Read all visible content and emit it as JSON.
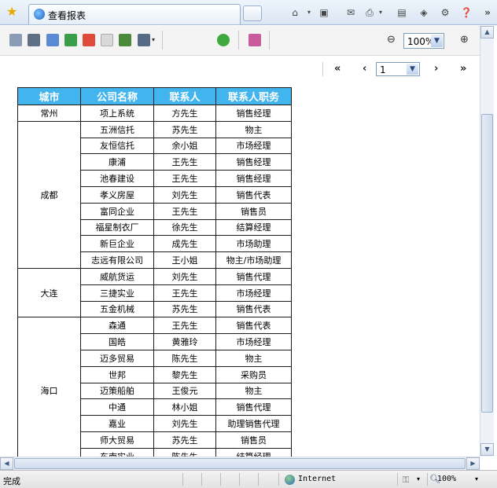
{
  "browser": {
    "tab_title": "查看报表",
    "status_text": "完成",
    "zone": "Internet",
    "zoom_status": "100%"
  },
  "toolbar": {
    "zoom_value": "100%",
    "buttons": [
      "preview-icon",
      "print-icon",
      "export-icon",
      "excel-icon",
      "pdf-icon",
      "text-icon",
      "save-icon",
      "view-menu-icon",
      "refresh-icon",
      "rss-icon"
    ]
  },
  "pager": {
    "first": "«",
    "prev": "‹",
    "page": "1",
    "next": "›",
    "last": "»"
  },
  "report": {
    "columns": [
      "城市",
      "公司名称",
      "联系人",
      "联系人职务"
    ],
    "groups": [
      {
        "city": "常州",
        "rows": [
          [
            "项上系统",
            "方先生",
            "销售经理"
          ]
        ]
      },
      {
        "city": "成都",
        "rows": [
          [
            "五洲信托",
            "苏先生",
            "物主"
          ],
          [
            "友恒信托",
            "余小姐",
            "市场经理"
          ],
          [
            "康浦",
            "王先生",
            "销售经理"
          ],
          [
            "池春建设",
            "王先生",
            "销售经理"
          ],
          [
            "孝义房屋",
            "刘先生",
            "销售代表"
          ],
          [
            "富同企业",
            "王先生",
            "销售员"
          ],
          [
            "福星制衣厂",
            "徐先生",
            "结算经理"
          ],
          [
            "新巨企业",
            "成先生",
            "市场助理"
          ],
          [
            "志远有限公司",
            "王小姐",
            "物主/市场助理"
          ]
        ]
      },
      {
        "city": "大连",
        "rows": [
          [
            "威航货运",
            "刘先生",
            "销售代理"
          ],
          [
            "三捷实业",
            "王先生",
            "市场经理"
          ],
          [
            "五金机械",
            "苏先生",
            "销售代表"
          ]
        ]
      },
      {
        "city": "海口",
        "rows": [
          [
            "森通",
            "王先生",
            "销售代表"
          ],
          [
            "国皓",
            "黄雅玲",
            "市场经理"
          ],
          [
            "迈多贸易",
            "陈先生",
            "物主"
          ],
          [
            "世邦",
            "黎先生",
            "采购员"
          ],
          [
            "迈策船舶",
            "王俊元",
            "物主"
          ],
          [
            "中通",
            "林小姐",
            "销售代理"
          ],
          [
            "嘉业",
            "刘先生",
            "助理销售代理"
          ],
          [
            "师大贸易",
            "苏先生",
            "销售员"
          ],
          [
            "东南实业",
            "陈先生",
            "结算经理"
          ]
        ]
      }
    ]
  }
}
